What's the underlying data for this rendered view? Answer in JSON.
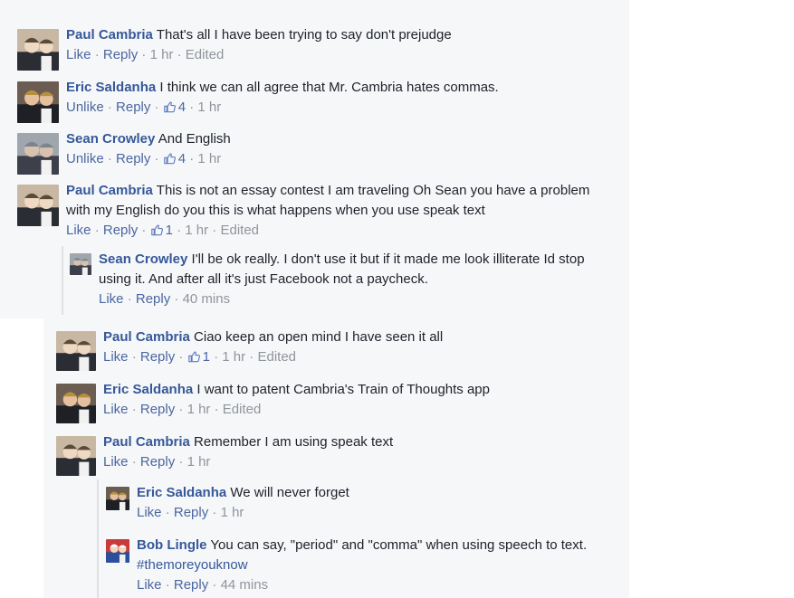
{
  "meta_labels": {
    "sep": "·"
  },
  "comments": [
    {
      "id": "c1",
      "author": "Paul Cambria",
      "text": "That's all I have been trying to say don't prejudge",
      "actions": [
        "Like",
        "Reply"
      ],
      "likes": null,
      "time": "1 hr",
      "edited": "Edited"
    },
    {
      "id": "c2",
      "author": "Eric Saldanha",
      "text": "I think we can all agree that Mr. Cambria hates commas.",
      "actions": [
        "Unlike",
        "Reply"
      ],
      "likes": "4",
      "time": "1 hr",
      "edited": null
    },
    {
      "id": "c3",
      "author": "Sean Crowley",
      "text": "And English",
      "actions": [
        "Unlike",
        "Reply"
      ],
      "likes": "4",
      "time": "1 hr",
      "edited": null
    },
    {
      "id": "c4",
      "author": "Paul Cambria",
      "text": "This is not an essay contest I am traveling Oh Sean you have a problem with my English do you this is what happens when you use speak text",
      "actions": [
        "Like",
        "Reply"
      ],
      "likes": "1",
      "time": "1 hr",
      "edited": "Edited"
    },
    {
      "id": "c5",
      "author": "Sean Crowley",
      "text": "I'll be ok really. I don't use it but if it made me look illiterate Id stop using it. And after all it's just Facebook not a paycheck.",
      "actions": [
        "Like",
        "Reply"
      ],
      "likes": null,
      "time": "40 mins",
      "edited": null
    },
    {
      "id": "c6",
      "author": "Paul Cambria",
      "text": "Ciao keep an open mind I have seen it all",
      "actions": [
        "Like",
        "Reply"
      ],
      "likes": "1",
      "time": "1 hr",
      "edited": "Edited"
    },
    {
      "id": "c7",
      "author": "Eric Saldanha",
      "text": "I want to patent Cambria's Train of Thoughts app",
      "actions": [
        "Like",
        "Reply"
      ],
      "likes": null,
      "time": "1 hr",
      "edited": "Edited"
    },
    {
      "id": "c8",
      "author": "Paul Cambria",
      "text": "Remember I am using speak text",
      "actions": [
        "Like",
        "Reply"
      ],
      "likes": null,
      "time": "1 hr",
      "edited": null
    },
    {
      "id": "c9",
      "author": "Eric Saldanha",
      "text": "We will never forget",
      "actions": [
        "Like",
        "Reply"
      ],
      "likes": null,
      "time": "1 hr",
      "edited": null
    },
    {
      "id": "c10",
      "author": "Bob Lingle",
      "text": "You can say, \"period\" and \"comma\" when using speech to text.",
      "hashtag": "#themoreyouknow",
      "actions": [
        "Like",
        "Reply"
      ],
      "likes": null,
      "time": "44 mins",
      "edited": null
    }
  ],
  "colors": {
    "link": "#365899",
    "meta": "#90949c",
    "action": "#4b67a1",
    "text": "#1d2129",
    "panel": "#f6f7f9"
  }
}
